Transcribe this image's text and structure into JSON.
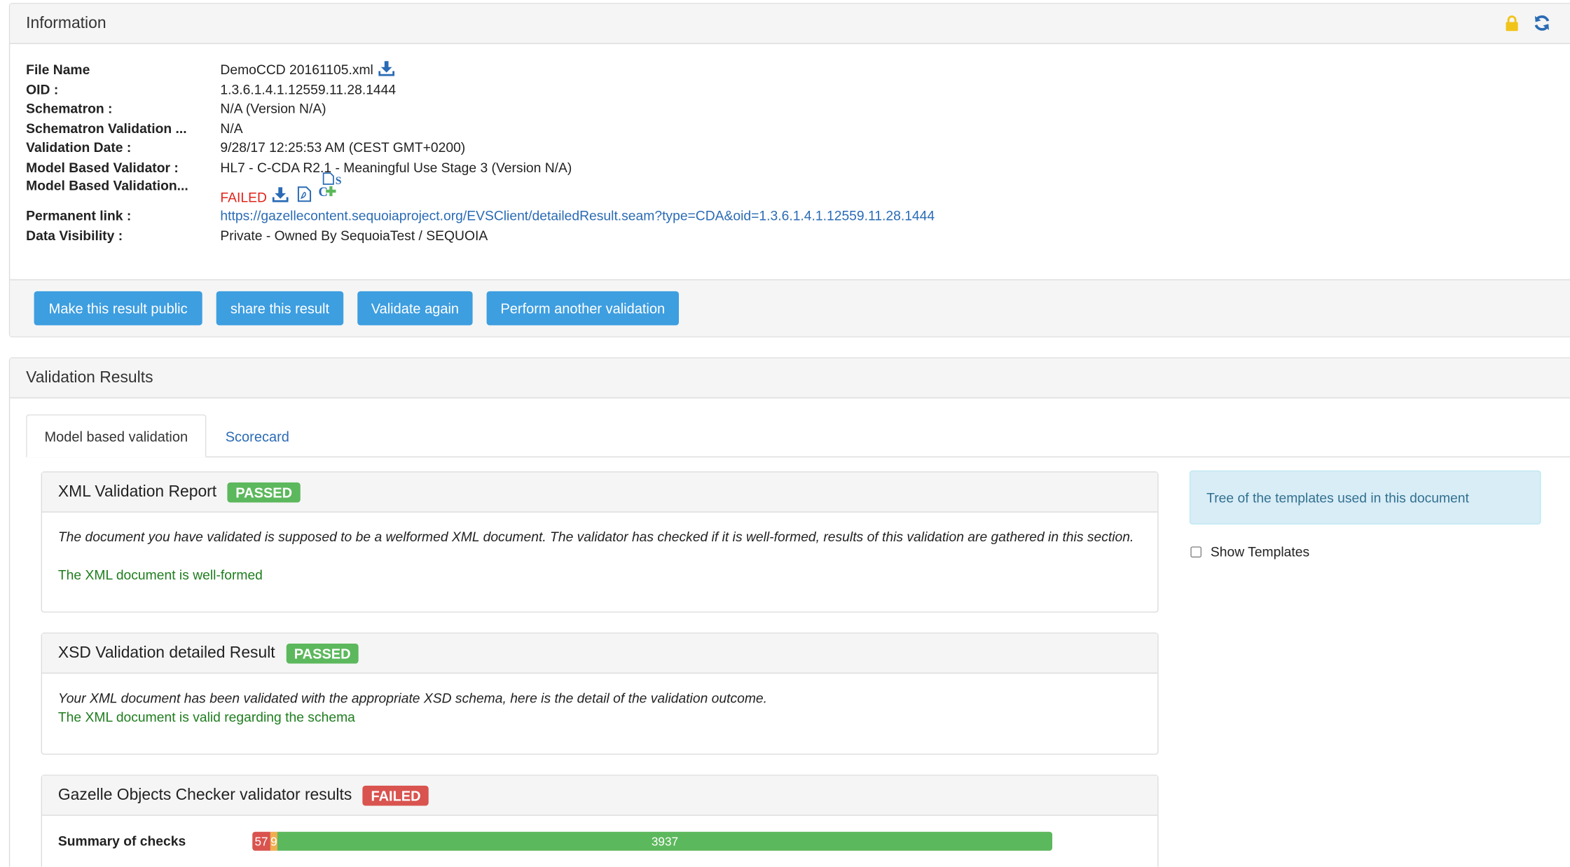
{
  "info_panel": {
    "title": "Information",
    "lock_icon": "lock-icon",
    "refresh_icon": "refresh-icon",
    "rows": [
      {
        "label": "File Name",
        "value": "DemoCCD 20161105.xml"
      },
      {
        "label": "OID :",
        "value": "1.3.6.1.4.1.12559.11.28.1444"
      },
      {
        "label": "Schematron :",
        "value": "N/A (Version N/A)"
      },
      {
        "label": "Schematron Validation ...",
        "value": "N/A"
      },
      {
        "label": "Validation Date :",
        "value": "9/28/17 12:25:53 AM (CEST GMT+0200)"
      },
      {
        "label": "Model Based Validator :",
        "value": "HL7 - C-CDA R2.1 - Meaningful Use Stage 3 (Version N/A)"
      },
      {
        "label": "Model Based Validation...",
        "value": "FAILED"
      },
      {
        "label": "Permanent link :",
        "value": "https://gazellecontent.sequoiaproject.org/EVSClient/detailedResult.seam?type=CDA&oid=1.3.6.1.4.1.12559.11.28.1444"
      },
      {
        "label": "Data Visibility :",
        "value": "Private - Owned By SequoiaTest / SEQUOIA"
      }
    ],
    "buttons": {
      "make_public": "Make this result public",
      "share": "share this result",
      "validate_again": "Validate again",
      "another": "Perform another validation"
    }
  },
  "results_panel": {
    "title": "Validation Results",
    "tabs": [
      "Model based validation",
      "Scorecard"
    ],
    "xml_report": {
      "title": "XML Validation Report",
      "status": "PASSED",
      "description": "The document you have validated is supposed to be a welformed XML document. The validator has checked if it is well-formed, results of this validation are gathered in this section.",
      "result": "The XML document is well-formed"
    },
    "xsd_report": {
      "title": "XSD Validation detailed Result",
      "status": "PASSED",
      "description": "Your XML document has been validated with the appropriate XSD schema, here is the detail of the validation outcome.",
      "result": "The XML document is valid regarding the schema"
    },
    "goc_report": {
      "title": "Gazelle Objects Checker validator results",
      "status": "FAILED",
      "summary_label": "Summary of checks",
      "summary": {
        "errors": 57,
        "warnings": 9,
        "passed": 3937
      }
    },
    "side": {
      "tree_text": "Tree of the templates used in this document",
      "show_templates": "Show Templates"
    }
  },
  "colors": {
    "accent": "#3d9ee0",
    "passed": "#5cb85c",
    "failed": "#d9534f",
    "warning": "#f0ad4e",
    "link": "#2a6bb5"
  }
}
